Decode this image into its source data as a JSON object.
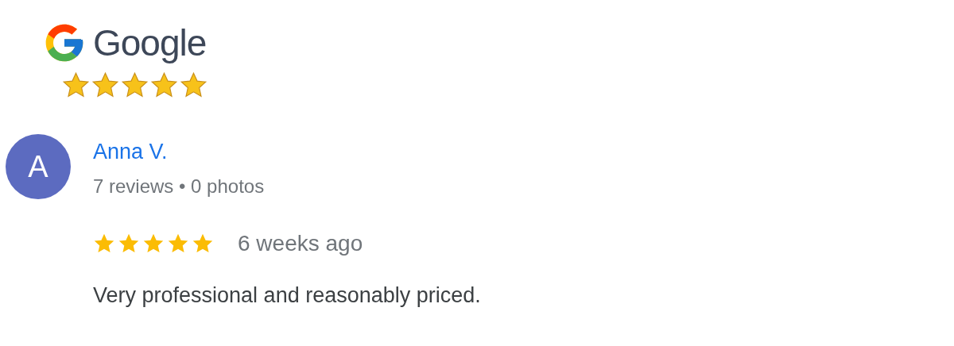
{
  "logo": {
    "text": "Google",
    "stars": 5
  },
  "review": {
    "avatar_letter": "A",
    "name": "Anna V.",
    "meta": "7 reviews • 0 photos",
    "stars": 5,
    "time": "6 weeks ago",
    "text": "Very professional and reasonably priced."
  }
}
